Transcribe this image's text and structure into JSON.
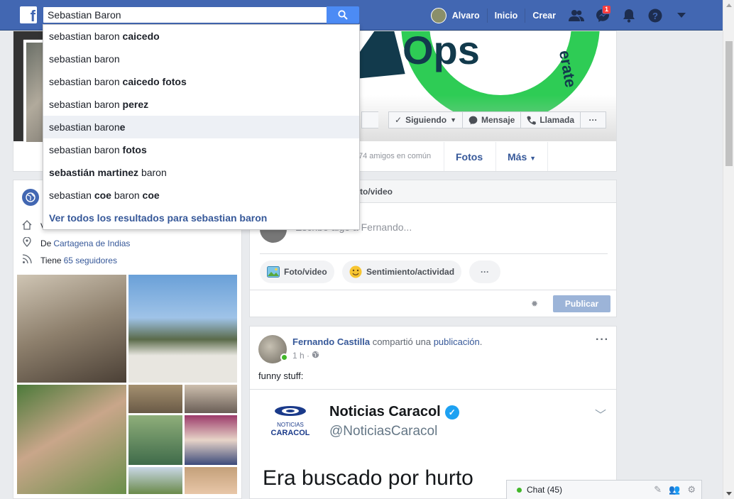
{
  "topbar": {
    "search_value": "Sebastian Baron",
    "user_name": "Alvaro",
    "nav_home": "Inicio",
    "nav_create": "Crear",
    "messages_badge": "1",
    "colors": {
      "bar": "#4267b2",
      "search_button": "#4c8bf5"
    }
  },
  "search_suggestions": [
    {
      "plain": "sebastian baron ",
      "bold": "caicedo",
      "after": ""
    },
    {
      "plain": "sebastian baron",
      "bold": "",
      "after": ""
    },
    {
      "plain": "sebastian baron ",
      "bold": "caicedo fotos",
      "after": ""
    },
    {
      "plain": "sebastian baron ",
      "bold": "perez",
      "after": ""
    },
    {
      "plain": "sebastian baron",
      "bold": "e",
      "after": ""
    },
    {
      "plain": "sebastian baron ",
      "bold": "fotos",
      "after": ""
    },
    {
      "plain": "",
      "bold": "sebastián martinez",
      "after": " baron"
    },
    {
      "plain": "sebastian ",
      "bold": "coe",
      "after": " baron ",
      "bold2": "coe"
    }
  ],
  "search_see_all": "Ver todos los resultados para sebastian baron",
  "profile": {
    "following_label": "Siguiendo",
    "message_label": "Mensaje",
    "call_label": "Llamada",
    "more_actions": "···",
    "friends_common": "74 amigos en común",
    "tab_photos": "Fotos",
    "tab_more": "Más"
  },
  "intro": {
    "line1_prefix": "V",
    "from_prefix": "De",
    "from_link": "Cartagena de Indias",
    "followers_prefix": "Tiene",
    "followers_link": "65 seguidores"
  },
  "composer": {
    "header": "to/video",
    "placeholder": "Escribe algo a Fernando...",
    "photo_video": "Foto/video",
    "feeling": "Sentimiento/actividad",
    "more": "···",
    "publish": "Publicar"
  },
  "post": {
    "author": "Fernando Castilla",
    "action": " compartió una ",
    "action_link": "publicación",
    "action_end": ".",
    "time": "1 h ·",
    "text": "funny stuff:",
    "more": "···",
    "embed": {
      "logo_text": "NOTICIAS CARACOL",
      "name": "Noticias Caracol",
      "handle": "@NoticiasCaracol",
      "body": "Era buscado por hurto"
    }
  },
  "chat": {
    "label": "Chat (45)"
  }
}
